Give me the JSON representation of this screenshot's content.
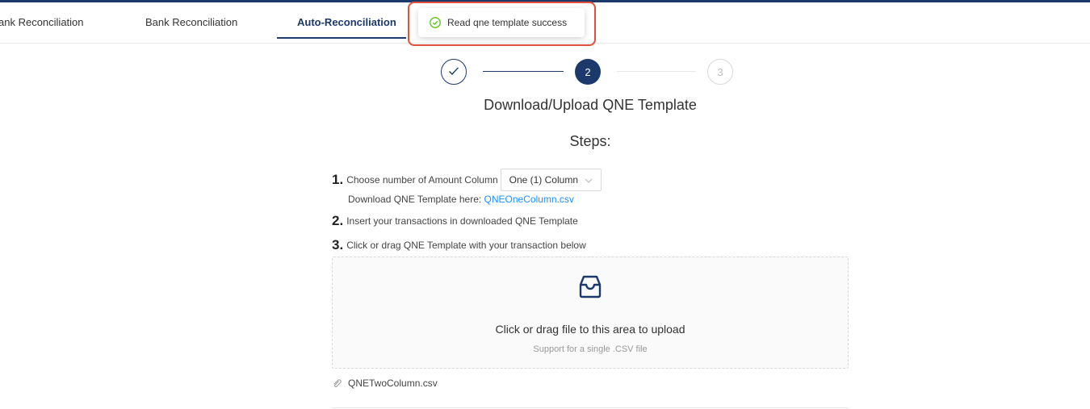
{
  "tabs": [
    {
      "label": "ank Reconciliation",
      "active": false
    },
    {
      "label": "Bank Reconciliation",
      "active": false
    },
    {
      "label": "Auto-Reconciliation",
      "active": true
    }
  ],
  "toast": {
    "message": "Read qne template success",
    "icon": "check-circle-icon",
    "status_color": "#52c41a"
  },
  "stepper": {
    "current": 2,
    "steps": [
      {
        "label": ""
      },
      {
        "label": "2"
      },
      {
        "label": "3"
      }
    ]
  },
  "title": "Download/Upload QNE Template",
  "steps_heading": "Steps:",
  "instructions": {
    "step1": {
      "number": "1.",
      "text": "Choose number of Amount Column",
      "select_value": "One (1) Column"
    },
    "download": {
      "text": "Download QNE Template here:",
      "link": "QNEOneColumn.csv"
    },
    "step2": {
      "number": "2.",
      "text": "Insert your transactions in downloaded QNE Template"
    },
    "step3": {
      "number": "3.",
      "text": "Click or drag QNE Template with your transaction below"
    }
  },
  "upload": {
    "icon": "inbox-icon",
    "text": "Click or drag file to this area to upload",
    "hint": "Support for a single .CSV file"
  },
  "uploaded_file": {
    "name": "QNETwoColumn.csv",
    "icon": "paperclip-icon"
  },
  "colors": {
    "primary": "#1b3a6b",
    "link": "#1890ff",
    "highlight": "#e0503c"
  }
}
